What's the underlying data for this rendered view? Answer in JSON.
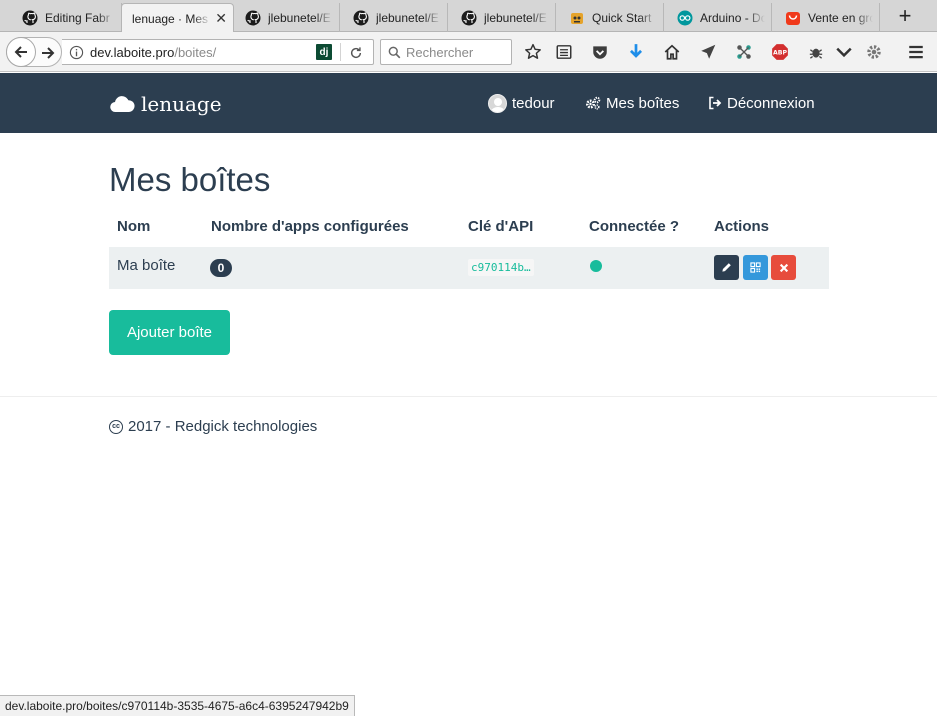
{
  "browser": {
    "tabs": [
      {
        "title": "Editing Fabr",
        "icon": "github-icon"
      },
      {
        "title": "lenuage · Mes",
        "icon": "",
        "active": true
      },
      {
        "title": "jlebunetel/E",
        "icon": "github-icon"
      },
      {
        "title": "jlebunetel/E",
        "icon": "github-icon"
      },
      {
        "title": "jlebunetel/E",
        "icon": "github-icon"
      },
      {
        "title": "Quick Start",
        "icon": "quickstart-icon"
      },
      {
        "title": "Arduino - Do",
        "icon": "arduino-icon"
      },
      {
        "title": "Vente en gro",
        "icon": "shop-icon"
      }
    ],
    "url_domain": "dev.laboite.pro",
    "url_path": "/boites/",
    "search_placeholder": "Rechercher",
    "status_url": "dev.laboite.pro/boites/c970114b-3535-4675-a6c4-6395247942b9"
  },
  "site": {
    "brand": "lenuage",
    "nav": {
      "user": "tedour",
      "boxes": "Mes boîtes",
      "logout": "Déconnexion"
    },
    "page_title": "Mes boîtes",
    "table": {
      "headers": [
        "Nom",
        "Nombre d'apps configurées",
        "Clé d'API",
        "Connectée ?",
        "Actions"
      ],
      "rows": [
        {
          "name": "Ma boîte",
          "apps": "0",
          "api_key": "c970114b…",
          "connected": true
        }
      ]
    },
    "add_button": "Ajouter boîte",
    "footer": "2017 - Redgick technologies",
    "colors": {
      "navbar": "#2c3e50",
      "accent": "#18bc9c",
      "info": "#3498db",
      "danger": "#e74c3c"
    }
  }
}
